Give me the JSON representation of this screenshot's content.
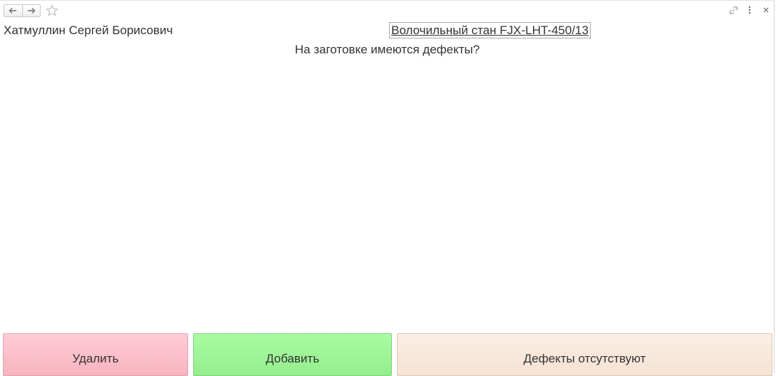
{
  "toolbar": {
    "back_icon": "arrow-left-icon",
    "forward_icon": "arrow-right-icon",
    "favorite_icon": "star-icon",
    "link_icon": "link-icon",
    "more_icon": "more-vertical-icon",
    "close_icon": "close-icon"
  },
  "header": {
    "user_name": "Хатмуллин Сергей Борисович",
    "machine": "Волочильный стан FJX-LHT-450/13"
  },
  "main": {
    "question": "На заготовке имеются дефекты?"
  },
  "actions": {
    "delete_label": "Удалить",
    "add_label": "Добавить",
    "no_defects_label": "Дефекты отсутствуют"
  },
  "colors": {
    "delete": "#f9bac6",
    "add": "#9ef497",
    "no_defects": "#f8e7da",
    "text": "#333333"
  }
}
